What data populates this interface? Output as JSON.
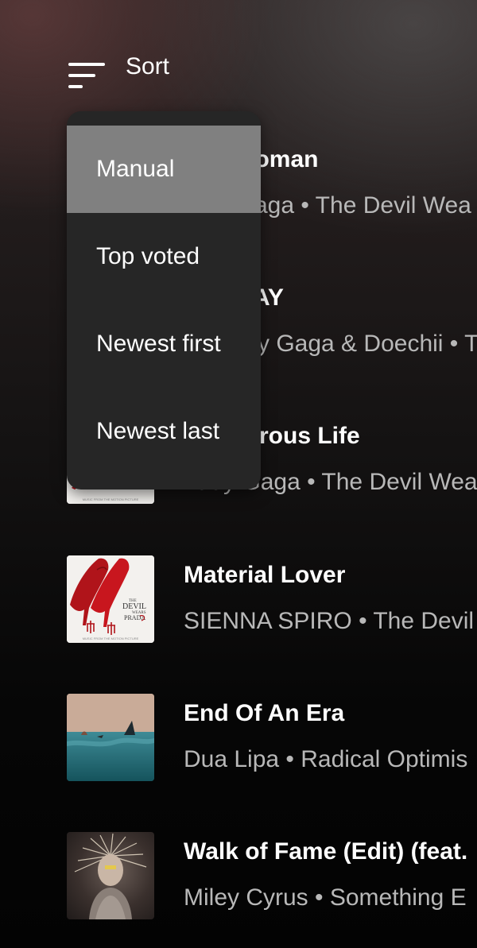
{
  "header": {
    "sort_label": "Sort"
  },
  "sort_menu": {
    "selected_index": 0,
    "options": [
      {
        "label": "Manual"
      },
      {
        "label": "Top voted"
      },
      {
        "label": "Newest first"
      },
      {
        "label": "Newest last"
      }
    ]
  },
  "tracks": [
    {
      "title": "of a Woman",
      "meta": "aga • The Devil Wea"
    },
    {
      "title": "AY",
      "meta": "y Gaga & Doechii • T"
    },
    {
      "title": "rous Life",
      "meta": "Lady Gaga • The Devil Wea"
    },
    {
      "title": "Material Lover",
      "meta": "SIENNA SPIRO • The Devil"
    },
    {
      "title": "End Of An Era",
      "meta": "Dua Lipa • Radical Optimis"
    },
    {
      "title": "Walk of Fame (Edit) (feat.",
      "meta": "Miley Cyrus • Something E"
    }
  ],
  "art": {
    "prada_title_line1": "THE",
    "prada_title_line2": "DEVIL",
    "prada_title_line3": "WEARS",
    "prada_title_line4": "PRADA",
    "prada_caption": "MUSIC FROM THE MOTION PICTURE"
  },
  "colors": {
    "menu_background": "#262626",
    "menu_selected": "#808080",
    "secondary_text": "#b8b8b8"
  }
}
